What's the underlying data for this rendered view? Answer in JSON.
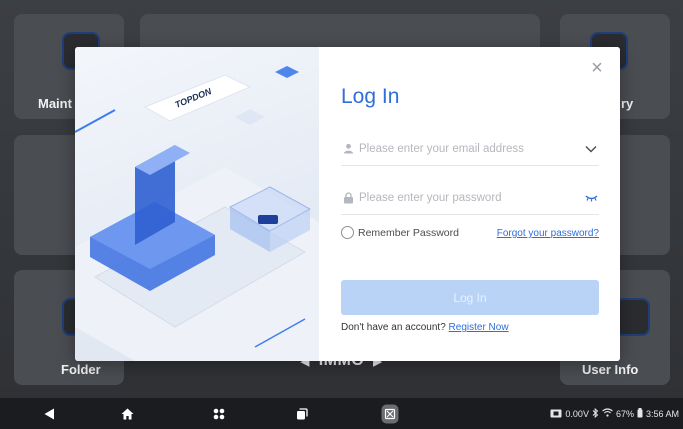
{
  "background": {
    "tiles": {
      "maintenance": "Maint",
      "history": "ry",
      "folder": "Folder",
      "user_info": "User Info"
    },
    "nav": {
      "prev": "◀",
      "label": "IMMO",
      "next": "▶"
    }
  },
  "illustration": {
    "brand": "TOPDON"
  },
  "login": {
    "title": "Log In",
    "email_placeholder": "Please enter your email address",
    "password_placeholder": "Please enter your password",
    "remember_label": "Remember Password",
    "forgot_label": "Forgot your password?",
    "submit_label": "Log In",
    "register_prompt": "Don't have an account?",
    "register_link": "Register Now",
    "close_symbol": "×"
  },
  "status_bar": {
    "voltage": "0.00V",
    "battery": "67%",
    "time": "3:56 AM"
  },
  "colors": {
    "accent": "#2f6fdb",
    "button_disabled": "#b9d3f7"
  }
}
